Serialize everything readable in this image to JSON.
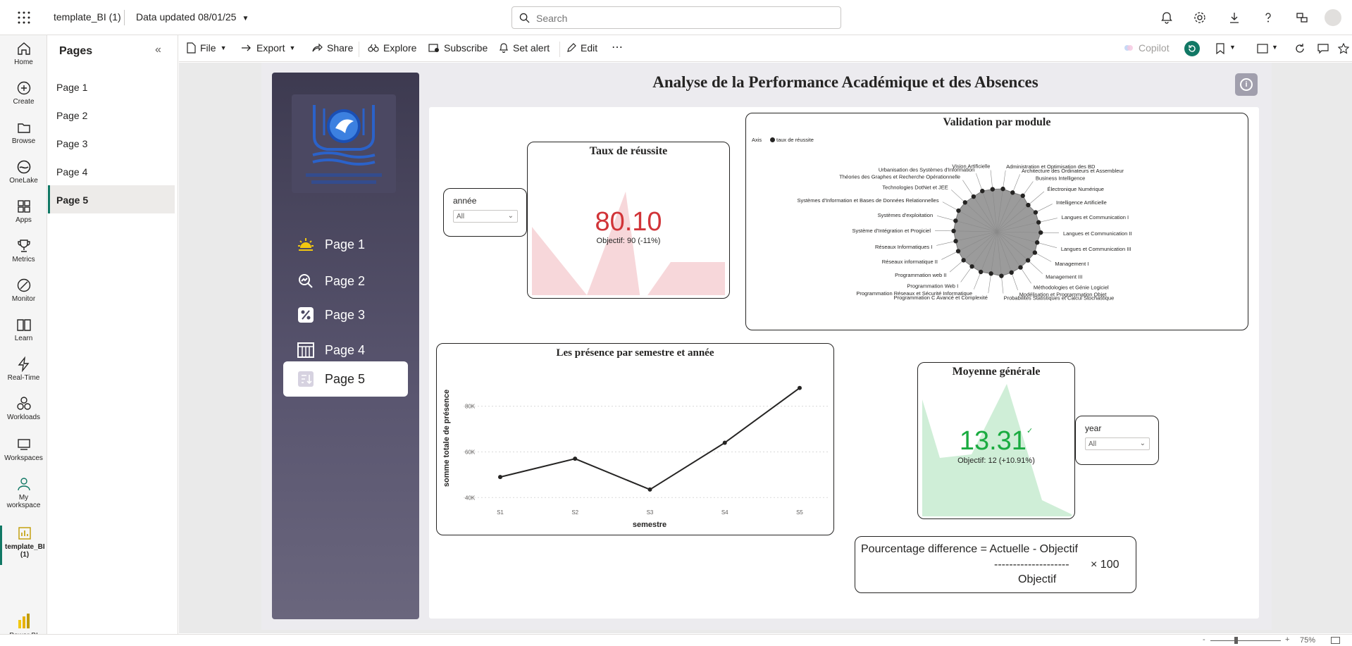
{
  "topbar": {
    "workspace_title": "template_BI (1)",
    "data_updated": "Data updated 08/01/25",
    "search_placeholder": "Search"
  },
  "leftnav": {
    "items": [
      {
        "label": "Home"
      },
      {
        "label": "Create"
      },
      {
        "label": "Browse"
      },
      {
        "label": "OneLake"
      },
      {
        "label": "Apps"
      },
      {
        "label": "Metrics"
      },
      {
        "label": "Monitor"
      },
      {
        "label": "Learn"
      },
      {
        "label": "Real-Time"
      },
      {
        "label": "Workloads"
      },
      {
        "label": "Workspaces"
      },
      {
        "label": "My workspace"
      },
      {
        "label": "template_BI (1)"
      },
      {
        "label": "Power BI"
      }
    ]
  },
  "pages_pane": {
    "title": "Pages",
    "items": [
      "Page 1",
      "Page 2",
      "Page 3",
      "Page 4",
      "Page 5"
    ],
    "selected": "Page 5"
  },
  "toolbar": {
    "file": "File",
    "export": "Export",
    "share": "Share",
    "explore": "Explore",
    "subscribe": "Subscribe",
    "set_alert": "Set alert",
    "edit": "Edit",
    "more": "⋯",
    "copilot": "Copilot"
  },
  "report": {
    "title": "Analyse de la Performance Académique et des Absences",
    "nav_buttons": [
      "Page 1",
      "Page 2",
      "Page 3",
      "Page 4",
      "Page 5"
    ],
    "slicer_annee": {
      "label": "année",
      "value": "All"
    },
    "slicer_year": {
      "label": "year",
      "value": "All"
    },
    "kpi_taux": {
      "title": "Taux de réussite",
      "value": "80.10",
      "target": "Objectif: 90 (-11%)",
      "color": "#d13438"
    },
    "kpi_moyenne": {
      "title": "Moyenne générale",
      "value": "13.31",
      "check": "✓",
      "target": "Objectif: 12 (+10.91%)",
      "color": "#1aab40"
    },
    "formula": {
      "line1": "Pourcentage difference = Actuelle - Objectif",
      "dashes": "--------------------",
      "times": "× 100",
      "denominator": "Objectif"
    },
    "radar": {
      "title": "Validation par module",
      "legend_axis": "Axis",
      "legend_series": "taux de réussite"
    }
  },
  "chart_data": [
    {
      "type": "line",
      "title": "Les présence par semestre et année",
      "xlabel": "semestre",
      "ylabel": "somme totale de présence",
      "categories": [
        "S1",
        "S2",
        "S3",
        "S4",
        "S5"
      ],
      "values": [
        49000,
        57000,
        43500,
        64000,
        88000
      ],
      "yticks": [
        "40K",
        "60K",
        "80K"
      ],
      "ylim": [
        37000,
        95000
      ],
      "grid": true
    },
    {
      "type": "radar",
      "title": "Validation par module",
      "series": [
        {
          "name": "taux de réussite",
          "values": [
            80,
            78,
            82,
            76,
            80,
            79,
            81,
            77,
            80,
            78,
            79,
            80,
            82,
            78,
            80,
            79,
            81,
            80,
            78,
            80,
            79,
            81,
            80,
            78,
            80,
            79
          ]
        }
      ],
      "categories": [
        "Administration et Optimisation des BD",
        "Architecture des Ordinateurs et Assembleur",
        "Business Intelligence",
        "Électronique Numérique",
        "Intelligence Artificielle",
        "Langues et Communication I",
        "Langues et Communication II",
        "Langues et Communication III",
        "Management I",
        "Management III",
        "Méthodologies et Génie Logiciel",
        "Modélisation et Programmation Objet",
        "Probabilités Statistiques et Calcul Stochastique",
        "Programmation C Avancé et Complexité",
        "Programmation Réseaux et Sécurité Informatique",
        "Programmation Web I",
        "Programmation web II",
        "Réseaux informatique II",
        "Réseaux Informatiques I",
        "Système d'Intégration et Progiciel",
        "Systèmes d'exploitation",
        "Systèmes d'Information et Bases de Données Relationnelles",
        "Technologies DotNet et JEE",
        "Théories des Graphes et Recherche Opérationnelle",
        "Urbanisation des Systèmes d'Information",
        "Vision Artificielle"
      ]
    }
  ],
  "statusbar": {
    "zoom_minus": "-",
    "zoom_plus": "+",
    "zoom": "75%"
  },
  "colors": {
    "accent": "#117865",
    "panel": "#3d3a50",
    "kpi_bad": "#d13438",
    "kpi_good": "#1aab40"
  }
}
